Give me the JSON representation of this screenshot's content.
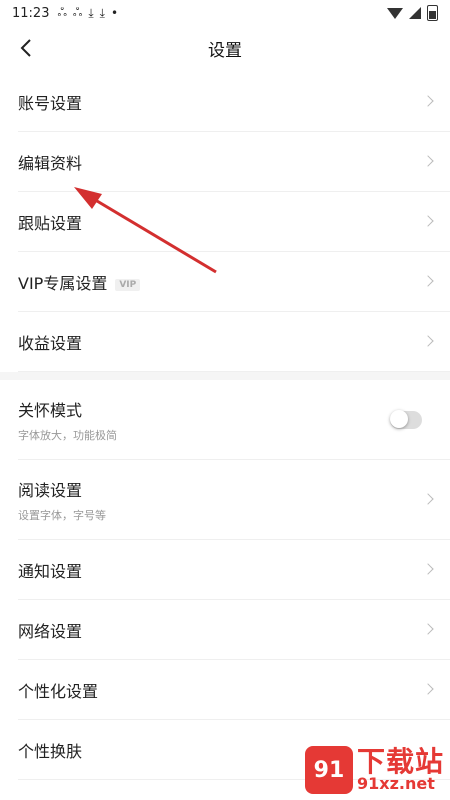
{
  "status_bar": {
    "time": "11:23",
    "icons": [
      "notification-icon",
      "notification-icon",
      "download-icon",
      "download-icon",
      "dot-icon"
    ],
    "right_icons": [
      "wifi-icon",
      "signal-icon",
      "battery-icon"
    ]
  },
  "header": {
    "back_icon": "chevron-left-icon",
    "title": "设置"
  },
  "section1": [
    {
      "label": "账号设置"
    },
    {
      "label": "编辑资料"
    },
    {
      "label": "跟贴设置"
    },
    {
      "label": "VIP专属设置",
      "badge": "VIP"
    },
    {
      "label": "收益设置"
    }
  ],
  "section2": {
    "care_mode": {
      "label": "关怀模式",
      "sub": "字体放大，功能极简",
      "toggle_on": false
    },
    "reading": {
      "label": "阅读设置",
      "sub": "设置字体，字号等"
    },
    "items": [
      {
        "label": "通知设置"
      },
      {
        "label": "网络设置"
      },
      {
        "label": "个性化设置"
      },
      {
        "label": "个性换肤"
      }
    ]
  },
  "watermark": {
    "logo_text": "91",
    "title": "下载站",
    "url": "91xz.net"
  },
  "annotation": {
    "color": "#d32f2f"
  }
}
